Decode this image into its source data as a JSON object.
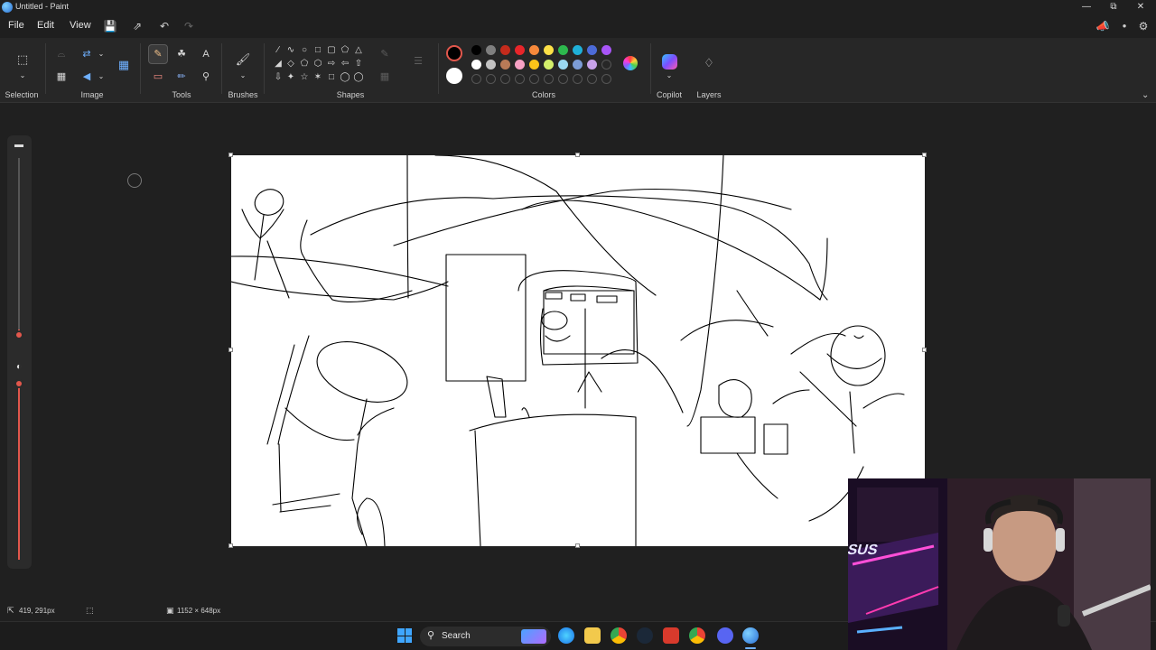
{
  "window": {
    "title": "Untitled - Paint",
    "minimize_icon": "minimize-icon",
    "restore_icon": "restore-icon",
    "close_icon": "close-icon"
  },
  "menu": {
    "file": "File",
    "edit": "Edit",
    "view": "View"
  },
  "ribbon": {
    "groups": {
      "selection": "Selection",
      "image": "Image",
      "tools": "Tools",
      "brushes": "Brushes",
      "shapes": "Shapes",
      "colors": "Colors",
      "copilot": "Copilot",
      "layers": "Layers"
    },
    "active_tool": "pencil",
    "primary_color": "#000000",
    "secondary_color": "#ffffff",
    "palette": [
      "#000000",
      "#7f7f7f",
      "#c42b1c",
      "#e8252a",
      "#f7893b",
      "#fde047",
      "#2db84d",
      "#1fb0d8",
      "#4c6bd8",
      "#a855f7",
      "#ffffff",
      "#c3c3c3",
      "#b97a57",
      "#f7a1c4",
      "#fcc419",
      "#d4f06b",
      "#9bd9f2",
      "#7c9cd6",
      "#c8a2ea"
    ]
  },
  "status": {
    "cursor_position": "419, 291px",
    "canvas_size": "1152 × 648px"
  },
  "taskbar": {
    "search_placeholder": "Search"
  }
}
